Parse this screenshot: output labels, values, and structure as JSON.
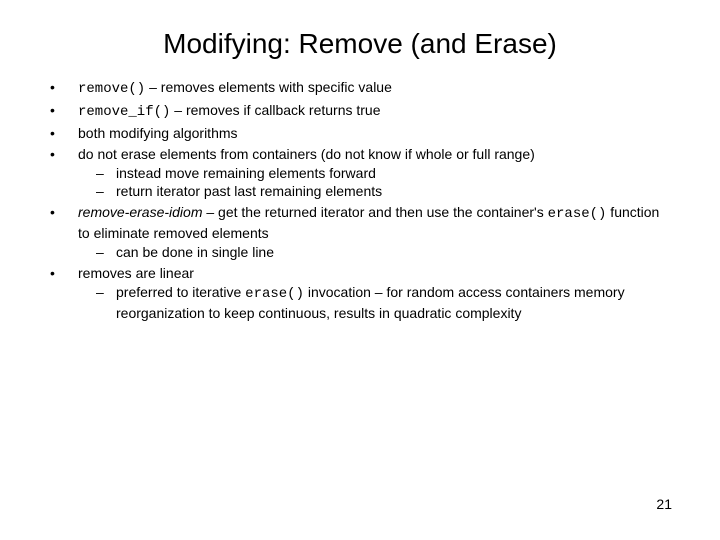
{
  "title": "Modifying: Remove (and Erase)",
  "bullets": {
    "b1": {
      "code": "remove()",
      "text": " – removes elements with specific value"
    },
    "b2": {
      "code": "remove_if()",
      "text": " – removes if callback returns true"
    },
    "b3": {
      "text": "both modifying algorithms"
    },
    "b4": {
      "text": "do not erase elements from containers (do not know if whole or full range)",
      "sub1": "instead move remaining elements forward",
      "sub2": "return iterator past last remaining elements"
    },
    "b5": {
      "italic": "remove-erase-idiom",
      "text1": " – get the returned iterator and then use the container's ",
      "code": "erase()",
      "text2": " function to eliminate removed elements",
      "sub1": "can be done in single line"
    },
    "b6": {
      "text": "removes are linear",
      "sub1a": "preferred to iterative ",
      "sub1code": "erase()",
      "sub1b": " invocation – for random access containers memory reorganization to keep continuous, results in quadratic complexity"
    }
  },
  "page_number": "21"
}
